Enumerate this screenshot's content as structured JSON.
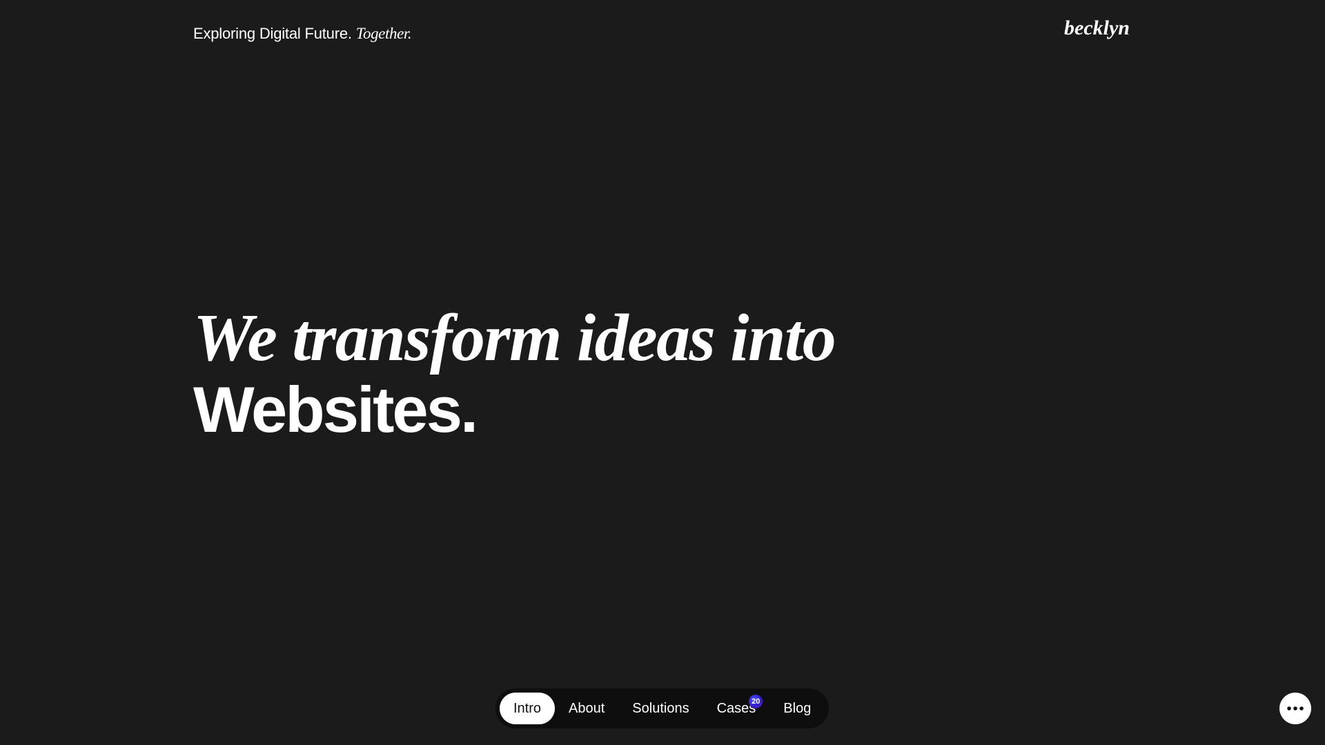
{
  "header": {
    "tagline": "Exploring Digital Future.",
    "tagline_emphasis": "Together.",
    "logo_text": "becklyn"
  },
  "hero": {
    "line1": "We transform ideas into",
    "line2": "Websites."
  },
  "nav": {
    "items": [
      {
        "label": "Intro",
        "active": true
      },
      {
        "label": "About",
        "active": false
      },
      {
        "label": "Solutions",
        "active": false
      },
      {
        "label": "Cases",
        "active": false,
        "badge": "20"
      },
      {
        "label": "Blog",
        "active": false
      }
    ]
  },
  "menu_button": {
    "icon": "more-dots-icon"
  },
  "colors": {
    "background": "#1b1b1b",
    "nav_background": "#0e0e0e",
    "text": "#ffffff",
    "badge": "#3120c9"
  }
}
